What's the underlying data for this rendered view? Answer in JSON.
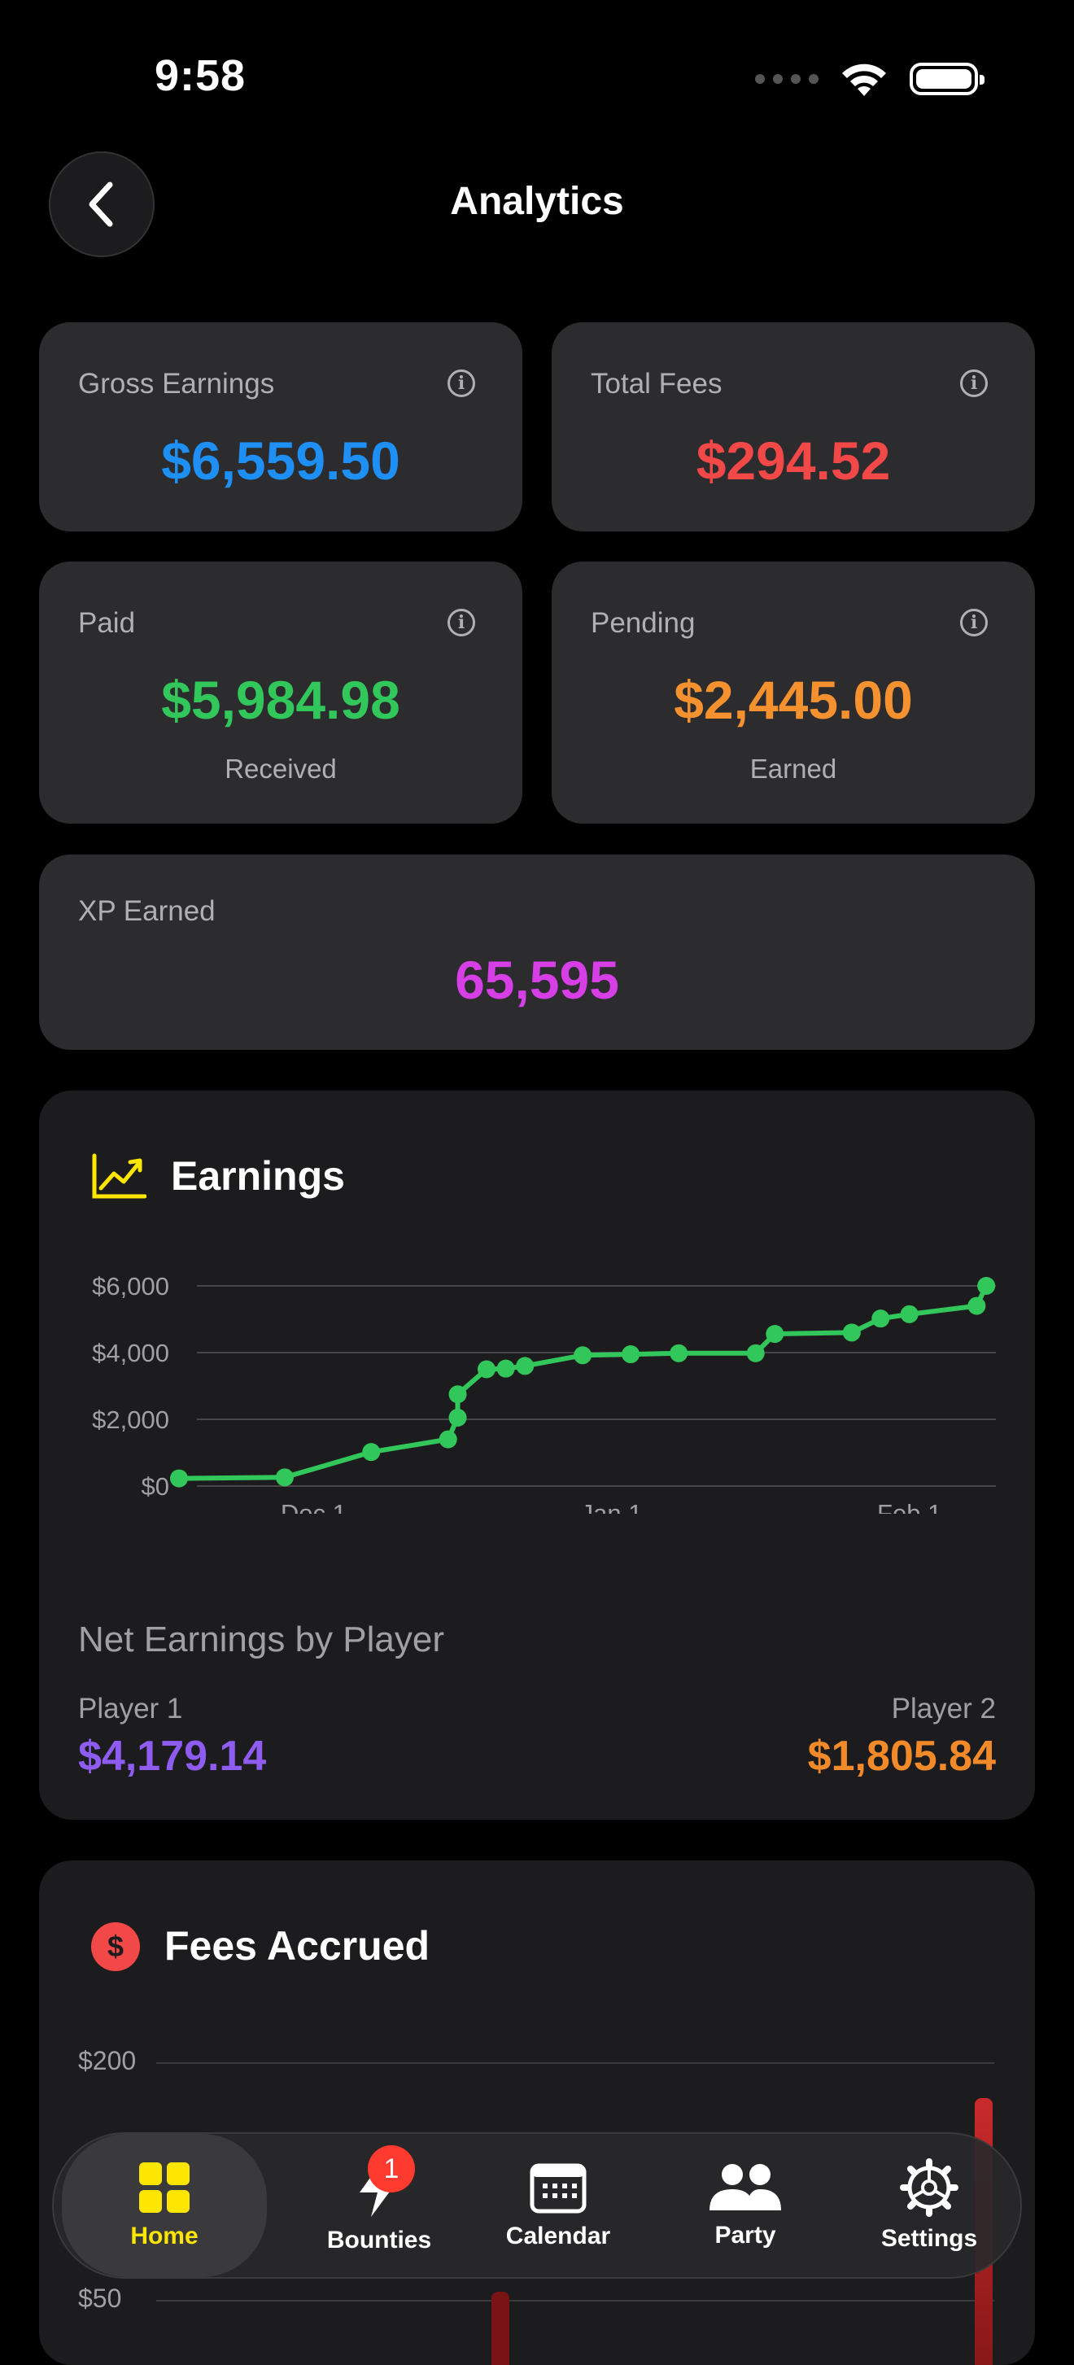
{
  "status": {
    "time": "9:58"
  },
  "header": {
    "title": "Analytics"
  },
  "cards": {
    "gross": {
      "label": "Gross Earnings",
      "value": "$6,559.50"
    },
    "fees": {
      "label": "Total Fees",
      "value": "$294.52"
    },
    "paid": {
      "label": "Paid",
      "value": "$5,984.98",
      "sub": "Received"
    },
    "pending": {
      "label": "Pending",
      "value": "$2,445.00",
      "sub": "Earned"
    },
    "xp": {
      "label": "XP Earned",
      "value": "65,595"
    }
  },
  "earnings": {
    "title": "Earnings",
    "net_label": "Net Earnings by Player",
    "players": [
      {
        "name": "Player 1",
        "value": "$4,179.14"
      },
      {
        "name": "Player 2",
        "value": "$1,805.84"
      }
    ]
  },
  "fees": {
    "title": "Fees Accrued"
  },
  "tabs": [
    {
      "label": "Home"
    },
    {
      "label": "Bounties",
      "badge": "1"
    },
    {
      "label": "Calendar"
    },
    {
      "label": "Party"
    },
    {
      "label": "Settings"
    }
  ],
  "colors": {
    "blue": "#1e8ff4",
    "red": "#f34848",
    "green": "#32c75a",
    "orange": "#f5922f",
    "magenta": "#d63ee6",
    "purple": "#8e5cf0",
    "player2": "#f28a2a",
    "yellow": "#ffe600"
  },
  "chart_data": [
    {
      "type": "line",
      "title": "Earnings",
      "y_ticks": [
        "$0",
        "$2,000",
        "$4,000",
        "$6,000"
      ],
      "x_ticks": [
        "Dec 1",
        "Jan 1",
        "Feb 1"
      ],
      "ylim": [
        0,
        6300
      ],
      "xlim": [
        "2024-11-17",
        "2025-02-10"
      ],
      "grid": true,
      "series": [
        {
          "points": [
            {
              "x": "2024-11-17",
              "y": 230
            },
            {
              "x": "2024-11-28",
              "y": 260
            },
            {
              "x": "2024-12-07",
              "y": 1020
            },
            {
              "x": "2024-12-15",
              "y": 1400
            },
            {
              "x": "2024-12-16",
              "y": 2050
            },
            {
              "x": "2024-12-16",
              "y": 2750
            },
            {
              "x": "2024-12-19",
              "y": 3500
            },
            {
              "x": "2024-12-21",
              "y": 3520
            },
            {
              "x": "2024-12-23",
              "y": 3600
            },
            {
              "x": "2024-12-29",
              "y": 3920
            },
            {
              "x": "2025-01-03",
              "y": 3950
            },
            {
              "x": "2025-01-08",
              "y": 3980
            },
            {
              "x": "2025-01-16",
              "y": 3980
            },
            {
              "x": "2025-01-18",
              "y": 4560
            },
            {
              "x": "2025-01-26",
              "y": 4600
            },
            {
              "x": "2025-01-29",
              "y": 5020
            },
            {
              "x": "2025-02-01",
              "y": 5150
            },
            {
              "x": "2025-02-08",
              "y": 5400
            },
            {
              "x": "2025-02-09",
              "y": 6000
            }
          ]
        }
      ]
    },
    {
      "type": "bar",
      "title": "Fees Accrued",
      "y_ticks": [
        "$200",
        "$50"
      ],
      "grid": true
    }
  ]
}
